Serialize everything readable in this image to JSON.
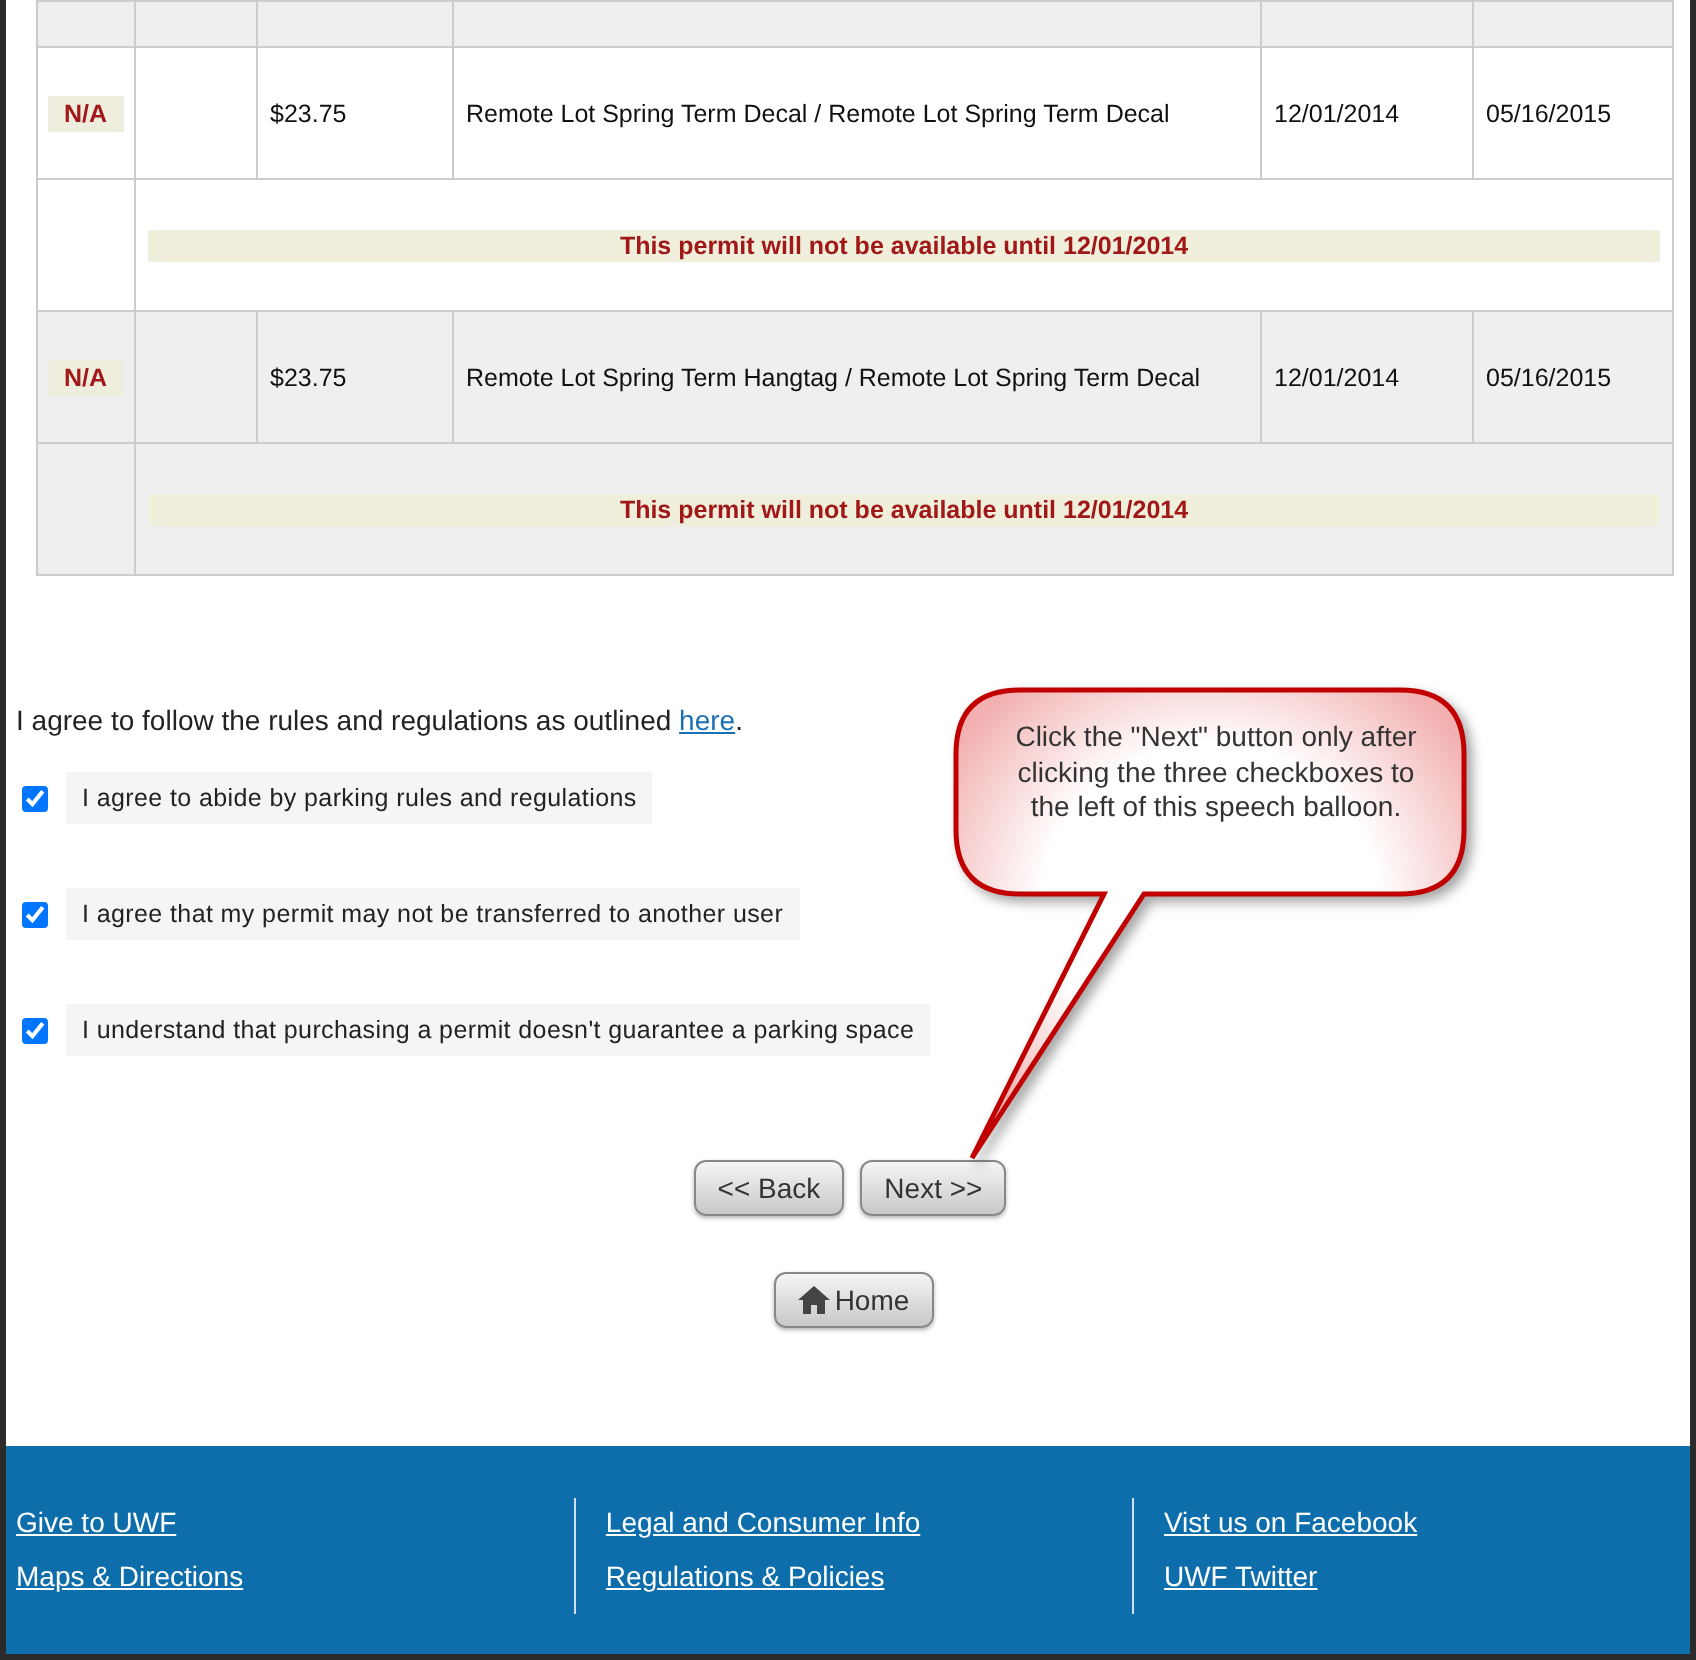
{
  "permits": [
    {
      "status": "N/A",
      "price": "$23.75",
      "description": "Remote Lot Spring Term Decal / Remote Lot Spring Term Decal",
      "start": "12/01/2014",
      "end": "05/16/2015",
      "notice": "This permit will not be available until 12/01/2014"
    },
    {
      "status": "N/A",
      "price": "$23.75",
      "description": "Remote Lot Spring Term Hangtag / Remote Lot Spring Term Decal",
      "start": "12/01/2014",
      "end": "05/16/2015",
      "notice": "This permit will not be available until 12/01/2014"
    }
  ],
  "agreement": {
    "text": "I agree to follow the rules and regulations as outlined ",
    "link": "here",
    "suffix": "."
  },
  "terms": [
    {
      "label": "I agree to abide by parking rules and regulations",
      "checked": true
    },
    {
      "label": "I agree that my permit may not be transferred to another user",
      "checked": true
    },
    {
      "label": "I understand that purchasing a permit doesn't guarantee a parking space",
      "checked": true
    }
  ],
  "callout": "Click the \"Next\" button only after clicking the three checkboxes to the left of this speech balloon.",
  "buttons": {
    "back": "<< Back",
    "next": "Next >>",
    "home": "Home"
  },
  "footer": [
    [
      "Give to UWF",
      "Maps & Directions"
    ],
    [
      "Legal and Consumer Info",
      "Regulations & Policies"
    ],
    [
      "Vist us on Facebook",
      "UWF Twitter"
    ]
  ]
}
